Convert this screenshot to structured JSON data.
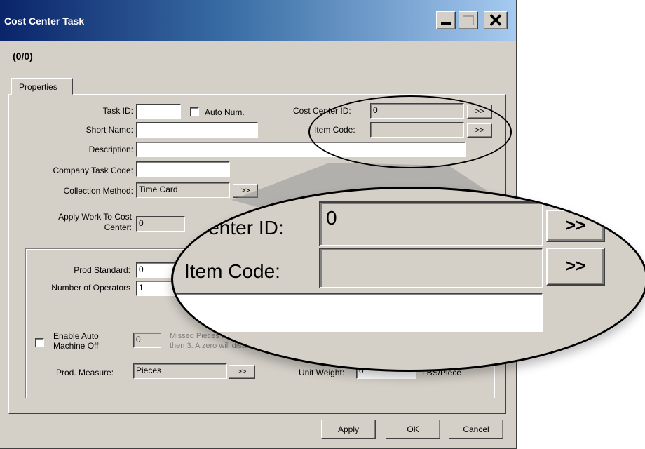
{
  "window": {
    "title": "Cost Center Task",
    "counter": "(0/0)",
    "controls": {
      "minimize": "minimize-icon",
      "maximize": "maximize-icon",
      "close": "close-icon"
    }
  },
  "tabs": [
    {
      "label": "Properties"
    }
  ],
  "form": {
    "task_id": {
      "label": "Task ID:",
      "value": ""
    },
    "auto_num": {
      "label": "Auto Num.",
      "checked": false
    },
    "cost_center_id": {
      "label": "Cost Center ID:",
      "value": "0",
      "browse": ">>"
    },
    "item_code": {
      "label": "Item Code:",
      "value": "",
      "browse": ">>"
    },
    "short_name": {
      "label": "Short Name:",
      "value": ""
    },
    "description": {
      "label": "Description:",
      "value": ""
    },
    "company_task_code": {
      "label": "Company Task Code:",
      "value": ""
    },
    "collection_method": {
      "label": "Collection Method:",
      "value": "Time Card",
      "browse": ">>"
    },
    "apply_work_to": {
      "label_line1": "Apply Work To Cost",
      "label_line2": "Center:",
      "value": "0"
    },
    "prod_standard": {
      "label": "Prod Standard:",
      "value": "0"
    },
    "number_of_operators": {
      "label": "Number of Operators",
      "value": "1"
    },
    "enable_auto_machine_off": {
      "label_line1": "Enable Auto",
      "label_line2": "Machine Off",
      "checked": false,
      "value": "0"
    },
    "missed_pieces_note": {
      "line1": "Missed Pieces starts",
      "line2": "then 3. A zero will disable this feature"
    },
    "prod_measure": {
      "label": "Prod. Measure:",
      "value": "Pieces",
      "browse": ">>"
    },
    "unit_weight": {
      "label": "Unit Weight:",
      "value": "0",
      "unit": "LBS/Piece"
    }
  },
  "buttons": {
    "apply": "Apply",
    "ok": "OK",
    "cancel": "Cancel"
  },
  "zoom": {
    "cost_center_label": "Center ID:",
    "cost_center_value": "0",
    "item_code_label": "Item Code:",
    "browse": ">>"
  }
}
